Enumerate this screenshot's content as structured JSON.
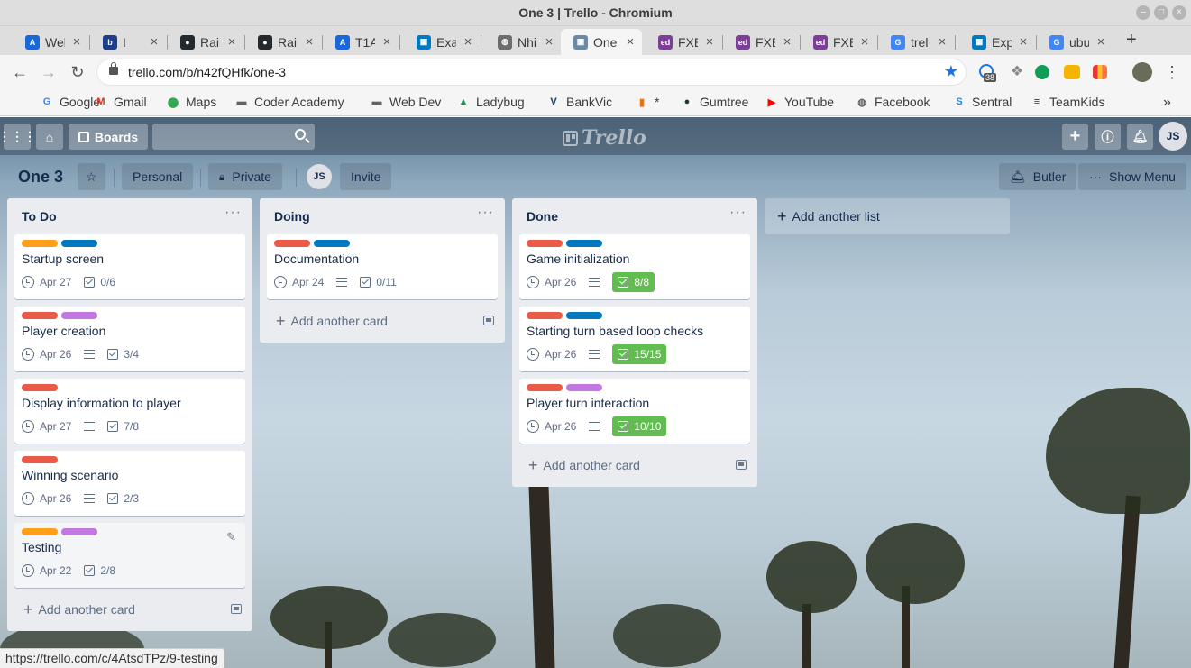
{
  "window": {
    "title": "One 3 | Trello - Chromium"
  },
  "tabs": [
    {
      "label": "Wel",
      "icon": "atlassian-icon",
      "color": "#1868db",
      "glyph": "A"
    },
    {
      "label": "I",
      "icon": "bootcamp-icon",
      "color": "#1c3f8c",
      "glyph": "b"
    },
    {
      "label": "Rain",
      "icon": "github-icon",
      "color": "#24292e",
      "glyph": "●"
    },
    {
      "label": "Rain",
      "icon": "github-icon",
      "color": "#24292e",
      "glyph": "●"
    },
    {
      "label": "T1A",
      "icon": "atlassian-icon",
      "color": "#1868db",
      "glyph": "A"
    },
    {
      "label": "Exa",
      "icon": "trello-icon",
      "color": "#0079bf",
      "glyph": "▦"
    },
    {
      "label": "Nhi",
      "icon": "globe-icon",
      "color": "#6d6d6d",
      "glyph": "◍"
    },
    {
      "label": "One",
      "icon": "trello-icon",
      "color": "#6b8aa6",
      "glyph": "▦",
      "active": true
    },
    {
      "label": "FXE",
      "icon": "ed-icon",
      "color": "#7b3f98",
      "glyph": "ed"
    },
    {
      "label": "FXE",
      "icon": "ed-icon",
      "color": "#7b3f98",
      "glyph": "ed"
    },
    {
      "label": "FXE",
      "icon": "ed-icon",
      "color": "#7b3f98",
      "glyph": "ed"
    },
    {
      "label": "trel",
      "icon": "google-icon",
      "color": "#4285f4",
      "glyph": "G"
    },
    {
      "label": "Exp",
      "icon": "trello-icon",
      "color": "#0079bf",
      "glyph": "▦"
    },
    {
      "label": "ubu",
      "icon": "google-icon",
      "color": "#4285f4",
      "glyph": "G"
    }
  ],
  "address": {
    "url": "trello.com/b/n42fQHfk/one-3"
  },
  "extensions": {
    "badge": "38"
  },
  "bookmarks": [
    {
      "label": "Google",
      "icon": "google-icon",
      "glyph": "G",
      "color": "#4285f4"
    },
    {
      "label": "Gmail",
      "icon": "gmail-icon",
      "glyph": "M",
      "color": "#d93025"
    },
    {
      "label": "Maps",
      "icon": "maps-pin-icon",
      "glyph": "⬤",
      "color": "#34a853"
    },
    {
      "label": "Coder Academy",
      "icon": "folder-icon",
      "glyph": "▬",
      "color": "#5f6368"
    },
    {
      "label": "Web Dev",
      "icon": "folder-icon",
      "glyph": "▬",
      "color": "#5f6368"
    },
    {
      "label": "Ladybug",
      "icon": "drive-icon",
      "glyph": "▲",
      "color": "#0f9d58"
    },
    {
      "label": "BankVic",
      "icon": "bankvic-icon",
      "glyph": "V",
      "color": "#1a3a6b"
    },
    {
      "label": "*",
      "icon": "gift-icon",
      "glyph": "▮",
      "color": "#e8710a"
    },
    {
      "label": "Gumtree",
      "icon": "gumtree-icon",
      "glyph": "●",
      "color": "#1d3a2b"
    },
    {
      "label": "YouTube",
      "icon": "youtube-icon",
      "glyph": "▶",
      "color": "#ff0000"
    },
    {
      "label": "Facebook",
      "icon": "globe-icon",
      "glyph": "◍",
      "color": "#5f6368"
    },
    {
      "label": "Sentral",
      "icon": "sentral-icon",
      "glyph": "S",
      "color": "#1e88e5"
    },
    {
      "label": "TeamKids",
      "icon": "teamkids-icon",
      "glyph": "≡",
      "color": "#333"
    }
  ],
  "header": {
    "boards_label": "Boards",
    "user_initials": "JS"
  },
  "board": {
    "title": "One 3",
    "team_label": "Personal",
    "visibility_label": "Private",
    "member_initials": "JS",
    "invite_label": "Invite",
    "butler_label": "Butler",
    "menu_label": "Show Menu"
  },
  "colors": {
    "orange": "#ff9f1a",
    "blue": "#0079bf",
    "red": "#eb5a46",
    "purple": "#c377e0",
    "green_badge": "#61bd4f"
  },
  "lists": [
    {
      "title": "To Do",
      "add_card_label": "Add another card",
      "cards": [
        {
          "labels": [
            "#ff9f1a",
            "#0079bf"
          ],
          "title": "Startup screen",
          "due": "Apr 27",
          "has_description": false,
          "checklist": "0/6",
          "complete": false
        },
        {
          "labels": [
            "#eb5a46",
            "#c377e0"
          ],
          "title": "Player creation",
          "due": "Apr 26",
          "has_description": true,
          "checklist": "3/4",
          "complete": false
        },
        {
          "labels": [
            "#eb5a46"
          ],
          "title": "Display information to player",
          "due": "Apr 27",
          "has_description": true,
          "checklist": "7/8",
          "complete": false
        },
        {
          "labels": [
            "#eb5a46"
          ],
          "title": "Winning scenario",
          "due": "Apr 26",
          "has_description": true,
          "checklist": "2/3",
          "complete": false
        },
        {
          "labels": [
            "#ff9f1a",
            "#c377e0"
          ],
          "title": "Testing",
          "due": "Apr 22",
          "has_description": false,
          "checklist": "2/8",
          "complete": false,
          "hovered": true
        }
      ]
    },
    {
      "title": "Doing",
      "add_card_label": "Add another card",
      "cards": [
        {
          "labels": [
            "#eb5a46",
            "#0079bf"
          ],
          "title": "Documentation",
          "due": "Apr 24",
          "has_description": true,
          "checklist": "0/11",
          "complete": false
        }
      ]
    },
    {
      "title": "Done",
      "add_card_label": "Add another card",
      "cards": [
        {
          "labels": [
            "#eb5a46",
            "#0079bf"
          ],
          "title": "Game initialization",
          "due": "Apr 26",
          "has_description": true,
          "checklist": "8/8",
          "complete": true
        },
        {
          "labels": [
            "#eb5a46",
            "#0079bf"
          ],
          "title": "Starting turn based loop checks",
          "due": "Apr 26",
          "has_description": true,
          "checklist": "15/15",
          "complete": true
        },
        {
          "labels": [
            "#eb5a46",
            "#c377e0"
          ],
          "title": "Player turn interaction",
          "due": "Apr 26",
          "has_description": true,
          "checklist": "10/10",
          "complete": true
        }
      ]
    }
  ],
  "add_list_label": "Add another list",
  "status_url": "https://trello.com/c/4AtsdTPz/9-testing"
}
